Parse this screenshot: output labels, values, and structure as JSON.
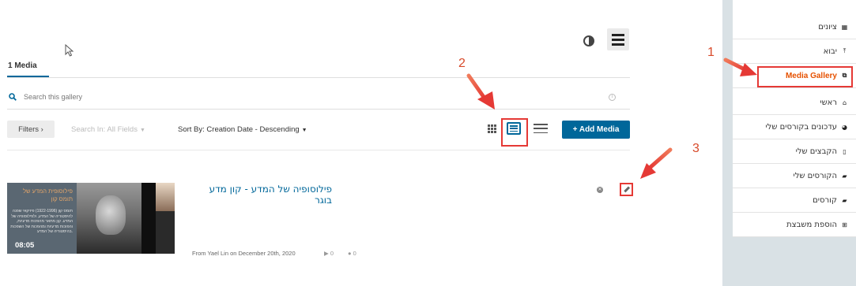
{
  "main": {
    "tab_label": "1 Media",
    "search_placeholder": "Search this gallery",
    "filters_label": "Filters ›",
    "search_in_label": "Search In: All Fields",
    "sort_by_label": "Sort By: Creation Date - Descending",
    "add_media_label": "+ Add Media"
  },
  "entry": {
    "title": "פילוסופיה של המדע - קון מדע בוגר",
    "duration": "08:05",
    "author_date": "From Yael Lin on December 20th, 2020",
    "plays": "0",
    "comments": "0",
    "thumb_title": "פילוסופית המדע של תומס קון",
    "thumb_text": "תומס קון (1922-1996) פיזיקאי שפנה להיסטוריה של המדע, ולפילוסופיה של המדע. קון מתאר מהפכות מדעיות, והפוכות מדעיות ומהפכות של השפכות בהיסטוריה של המדע."
  },
  "sidebar": {
    "items": [
      {
        "label": "ציונים",
        "icon": "table-icon",
        "glyph": "▦"
      },
      {
        "label": "יבוא",
        "icon": "import-icon",
        "glyph": "⤒"
      },
      {
        "label": "Media Gallery",
        "icon": "media-gallery-icon",
        "glyph": "⧉"
      },
      {
        "label": "ראשי",
        "icon": "home-icon",
        "glyph": "⌂"
      },
      {
        "label": "עדכונים בקורסים שלי",
        "icon": "dashboard-icon",
        "glyph": "◕"
      },
      {
        "label": "הקבצים שלי",
        "icon": "file-icon",
        "glyph": "▯"
      },
      {
        "label": "הקורסים שלי",
        "icon": "graduation-cap-icon",
        "glyph": "▰"
      },
      {
        "label": "קורסים",
        "icon": "graduation-cap-icon",
        "glyph": "▰"
      },
      {
        "label": "הוספת משבצת",
        "icon": "plus-square-icon",
        "glyph": "⊞"
      }
    ]
  },
  "annotations": {
    "step1": "1",
    "step2": "2",
    "step3": "3"
  },
  "colors": {
    "accent": "#00679a",
    "annotation": "#e53935",
    "active_nav": "#e65100"
  }
}
